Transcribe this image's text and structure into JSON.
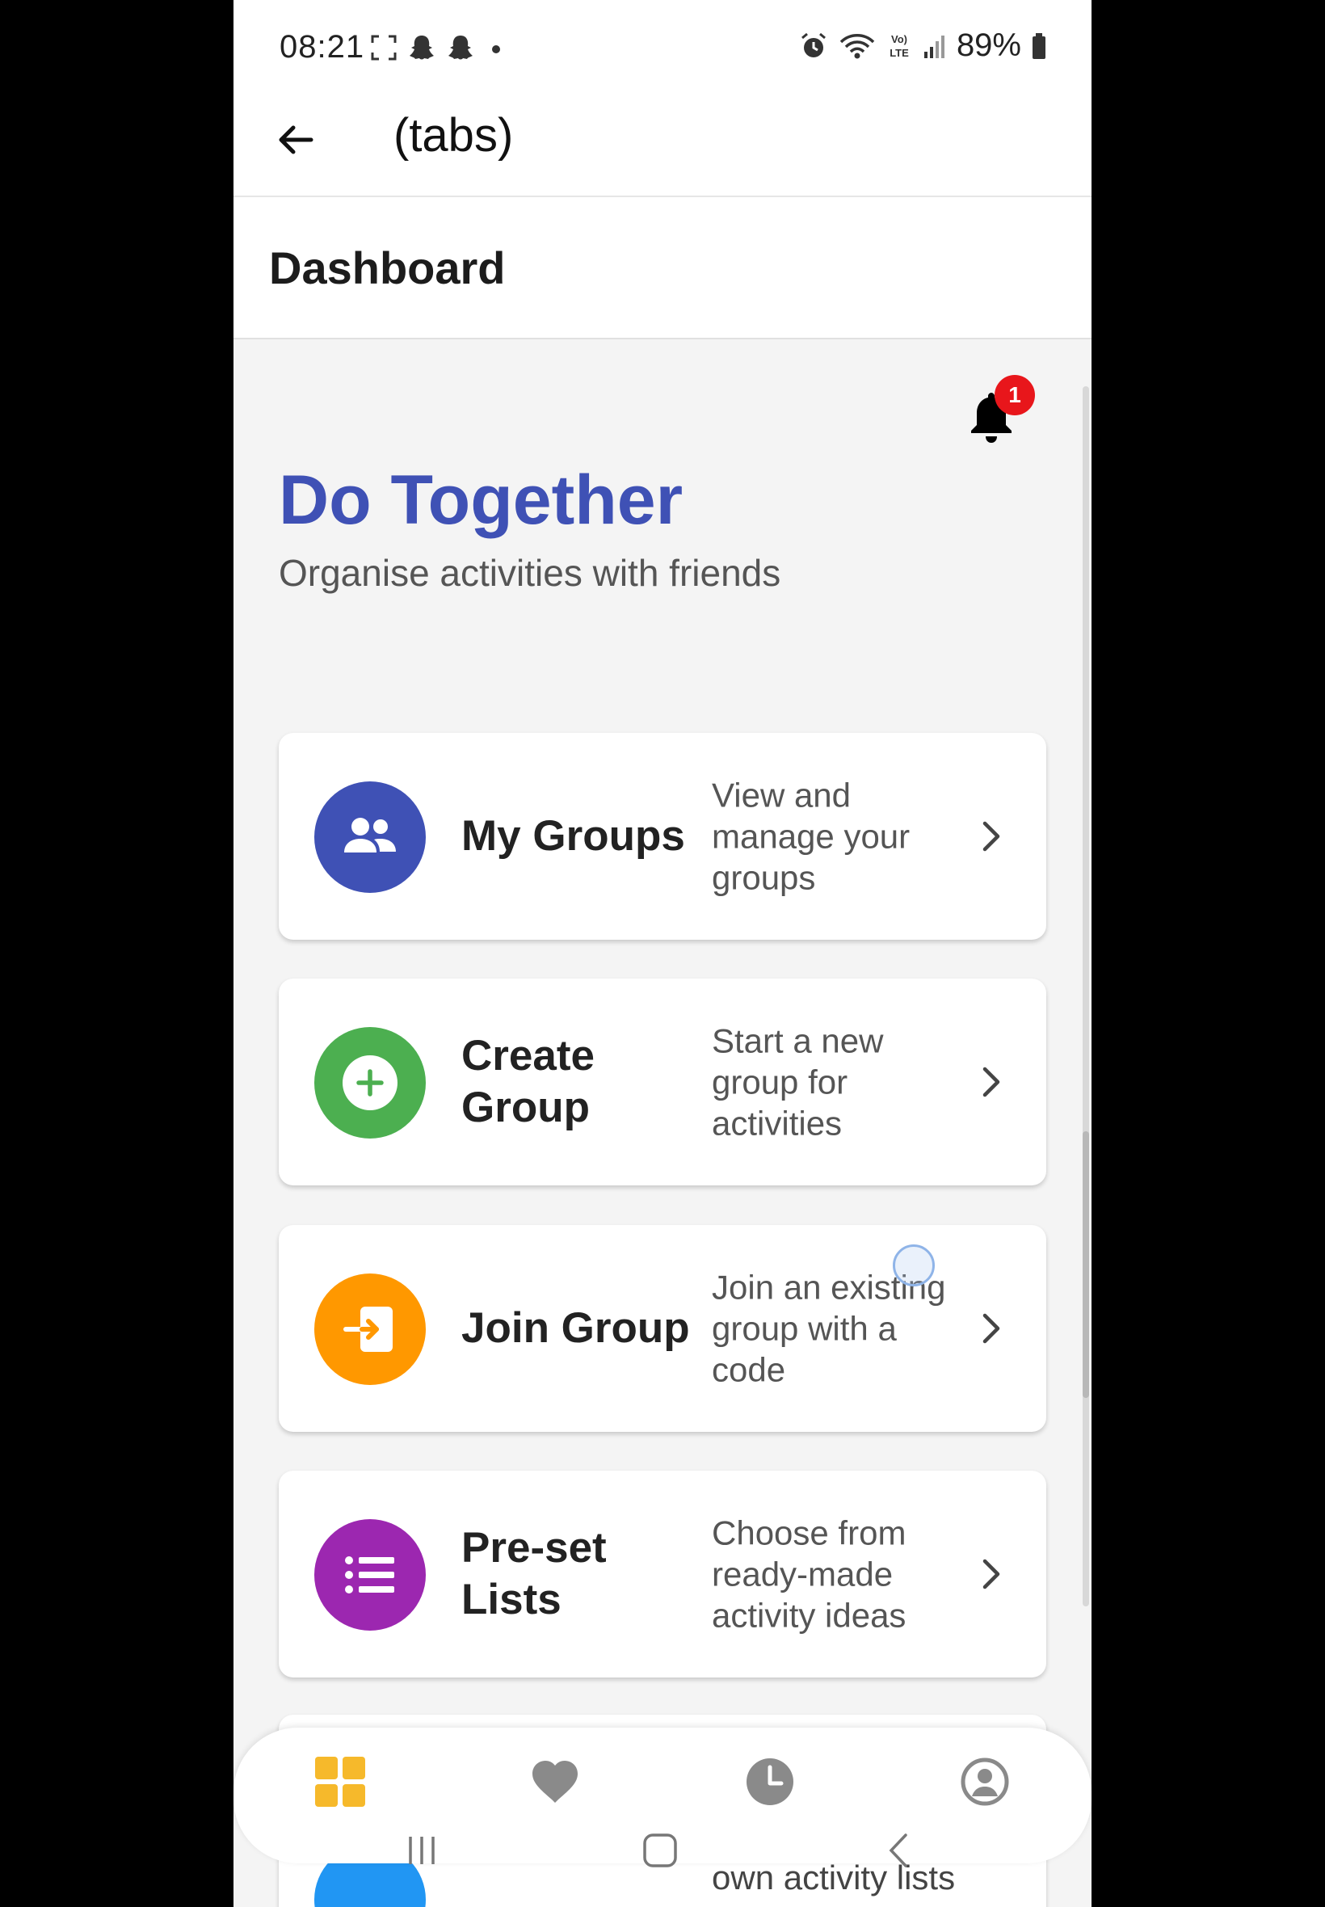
{
  "status_bar": {
    "time": "08:21",
    "battery": "89%",
    "icons": [
      "screenshot-icon",
      "snapchat-icon",
      "snapchat-icon",
      "dot-icon",
      "alarm-icon",
      "wifi-icon",
      "volte-icon",
      "signal-icon",
      "battery-icon"
    ]
  },
  "app_bar": {
    "title": "(tabs)",
    "back_icon": "arrow-left-icon"
  },
  "screen_header": {
    "title": "Dashboard"
  },
  "notifications": {
    "icon": "bell-icon",
    "count": "1"
  },
  "hero": {
    "title": "Do Together",
    "subtitle": "Organise activities with friends"
  },
  "cards": [
    {
      "title": "My Groups",
      "description": "View and manage your groups",
      "icon": "groups-icon",
      "color": "#3f51b5"
    },
    {
      "title": "Create Group",
      "description": "Start a new group for activities",
      "icon": "add-circle-icon",
      "color": "#4caf50"
    },
    {
      "title": "Join Group",
      "description": "Join an existing group with a code",
      "icon": "login-icon",
      "color": "#ff9800"
    },
    {
      "title": "Pre-set Lists",
      "description": "Choose from ready-made activity ideas",
      "icon": "list-icon",
      "color": "#9c27b0"
    },
    {
      "description": "own activity lists",
      "icon": "list-icon",
      "color": "#2196f3"
    }
  ],
  "tab_bar": {
    "tabs": [
      {
        "name": "dashboard",
        "icon": "grid-icon",
        "color": "#f6b92b",
        "active": true
      },
      {
        "name": "favorites",
        "icon": "heart-icon",
        "color": "#8a8a8a",
        "active": false
      },
      {
        "name": "history",
        "icon": "clock-icon",
        "color": "#8a8a8a",
        "active": false
      },
      {
        "name": "profile",
        "icon": "account-circle-icon",
        "color": "#8a8a8a",
        "active": false
      }
    ]
  },
  "system_nav": {
    "buttons": [
      "recents-icon",
      "home-icon",
      "back-icon"
    ]
  }
}
